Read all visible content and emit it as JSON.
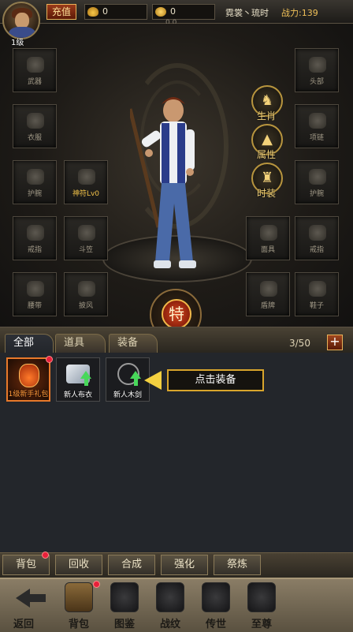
{
  "top_bar": {
    "level": "1级",
    "recharge_label": "充值",
    "ingot_value": "0",
    "gold_value": "0",
    "small_text": "0.0",
    "player_name": "霓裳丶琉时",
    "power_text": "战力:139"
  },
  "equip": {
    "left_slots": [
      "武器",
      "衣服",
      "护腕",
      "戒指",
      "腰带"
    ],
    "mid_left_slots": [
      "神符Lv0",
      "斗笠",
      "披风"
    ],
    "right_slots": [
      "头部",
      "项链",
      "护腕",
      "戒指",
      "鞋子"
    ],
    "mid_right_slots": [
      "面具",
      "盾牌"
    ],
    "side_buttons": [
      "生肖",
      "属性",
      "时装"
    ],
    "special_button": "特"
  },
  "bag": {
    "tabs": [
      "全部",
      "道具",
      "装备"
    ],
    "capacity": "3/50",
    "plus": "+",
    "items": [
      "1级新手礼包",
      "新人布衣",
      "新人木剑"
    ],
    "hint": "点击装备"
  },
  "actions": [
    "背包",
    "回收",
    "合成",
    "强化",
    "祭炼"
  ],
  "nav": [
    "返回",
    "背包",
    "图鉴",
    "战纹",
    "传世",
    "至尊"
  ]
}
